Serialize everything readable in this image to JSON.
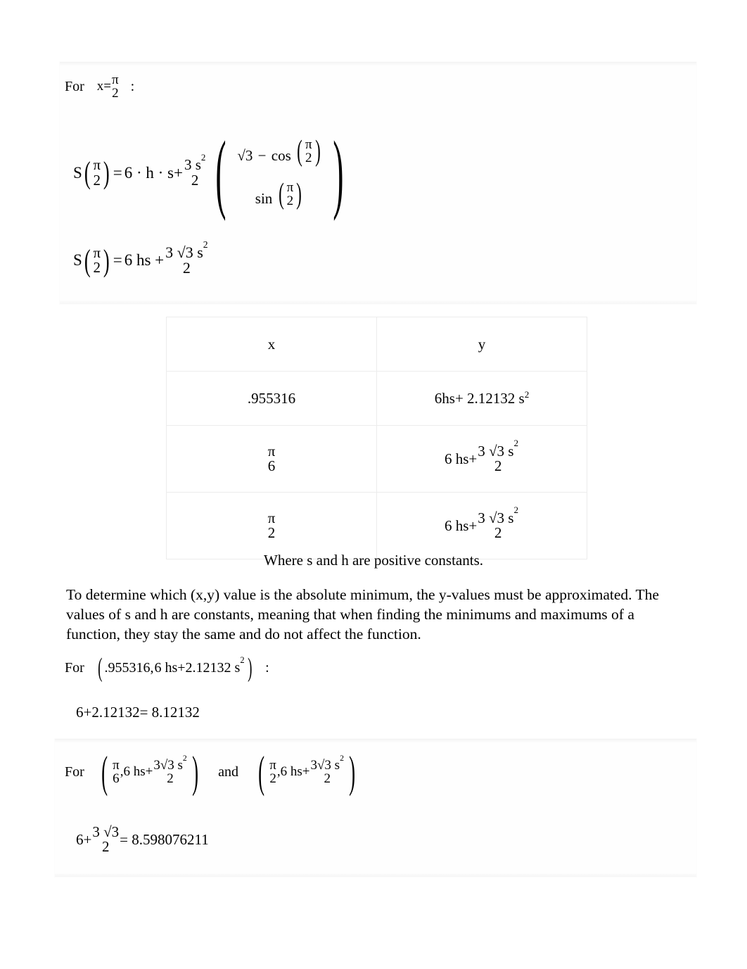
{
  "document": {
    "page_background": "#ffffff",
    "text_color": "#000000"
  },
  "section_1": {
    "for_label": "For",
    "x_assign": "x=",
    "x_value_num": "π",
    "x_value_den": "2",
    "colon": ":"
  },
  "equation_1": {
    "lhs_fn": "S",
    "lhs_arg_num": "π",
    "lhs_arg_den": "2",
    "equals": "=",
    "term_1": "6 · h · s+",
    "coef_num": "3 s",
    "coef_num_exp": "2",
    "coef_den": "2",
    "inner_num_radical": "√3",
    "inner_num_minus": "−",
    "inner_num_cos": "cos",
    "inner_num_cos_arg_num": "π",
    "inner_num_cos_arg_den": "2",
    "inner_den_sin": "sin",
    "inner_den_sin_arg_num": "π",
    "inner_den_sin_arg_den": "2"
  },
  "equation_2": {
    "lhs_fn": "S",
    "lhs_arg_num": "π",
    "lhs_arg_den": "2",
    "equals": "=",
    "term_1": "6 hs +",
    "frac_num": "3 √3 s",
    "frac_num_exp": "2",
    "frac_den": "2"
  },
  "table": {
    "headers": [
      "x",
      "y"
    ],
    "rows": [
      {
        "x_type": "decimal",
        "x_value": ".955316",
        "y_type": "inline",
        "y_value": "6hs+ 2.12132 s",
        "y_exp": "2"
      },
      {
        "x_type": "fraction",
        "x_num": "π",
        "x_den": "6",
        "y_type": "fraction",
        "y_prefix": "6 hs+",
        "y_num": "3 √3 s",
        "y_num_exp": "2",
        "y_den": "2"
      },
      {
        "x_type": "fraction",
        "x_num": "π",
        "x_den": "2",
        "y_type": "fraction",
        "y_prefix": "6 hs+",
        "y_num": "3 √3 s",
        "y_num_exp": "2",
        "y_den": "2"
      }
    ]
  },
  "caption": {
    "text": "Where s and h are positive constants."
  },
  "body_paragraph": {
    "text": "To determine which (x,y) value is the absolute minimum, the y-values must be approximated. The values of s and h are constants, meaning that when finding the minimums and maximums of a function, they stay the same and do not affect the function."
  },
  "section_2": {
    "for_label": "For",
    "pair_open": "(",
    "pair_x": ".955316,",
    "pair_y_prefix": "6 hs+2.12132 s",
    "pair_y_exp": "2",
    "pair_close": ")",
    "colon": ":"
  },
  "calc_1": {
    "text": "6+2.12132= 8.12132"
  },
  "section_3": {
    "for_label": "For",
    "and_label": "and",
    "pair_a": {
      "x_num": "π",
      "x_den": "6",
      "y_prefix": ",6 hs+",
      "y_num": "3√3 s",
      "y_num_exp": "2",
      "y_den": "2"
    },
    "pair_b": {
      "x_num": "π",
      "x_den": "2",
      "y_prefix": ",6 hs+",
      "y_num": "3√3 s",
      "y_num_exp": "2",
      "y_den": "2"
    }
  },
  "calc_2": {
    "lead": "6+",
    "frac_num": "3 √3",
    "frac_den": "2",
    "equals_result": "= 8.598076211"
  }
}
